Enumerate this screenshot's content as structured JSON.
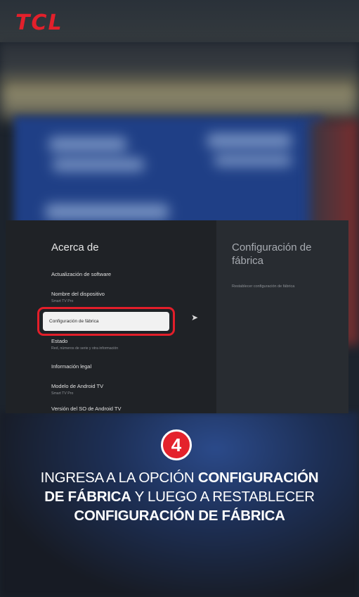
{
  "brand": "TCL",
  "settings": {
    "section_title": "Acerca de",
    "items": [
      {
        "label": "Actualización de software",
        "sub": ""
      },
      {
        "label": "Nombre del dispositivo",
        "sub": "Smart TV Pro"
      },
      {
        "label": "Configuración de fábrica",
        "sub": ""
      },
      {
        "label": "Estado",
        "sub": "Red, números de serie y otra información"
      },
      {
        "label": "Información legal",
        "sub": ""
      },
      {
        "label": "Modelo de Android TV",
        "sub": "Smart TV Pro"
      },
      {
        "label": "Versión del SO de Android TV",
        "sub": ""
      }
    ],
    "detail_title": "Configuración de fábrica",
    "detail_desc": "Restablecer configuración de fábrica"
  },
  "step_number": "4",
  "caption": {
    "line1_normal": "INGRESA A LA OPCIÓN ",
    "line1_bold": "CONFIGURACIÓN",
    "line2_bold": "DE FÁBRICA",
    "line2_normal": " Y LUEGO A RESTABLECER",
    "line3_bold": "CONFIGURACIÓN DE FÁBRICA"
  },
  "colors": {
    "accent_red": "#e31e2a",
    "panel_bg": "#1f2226",
    "focus_bg": "#f1f1f1"
  }
}
